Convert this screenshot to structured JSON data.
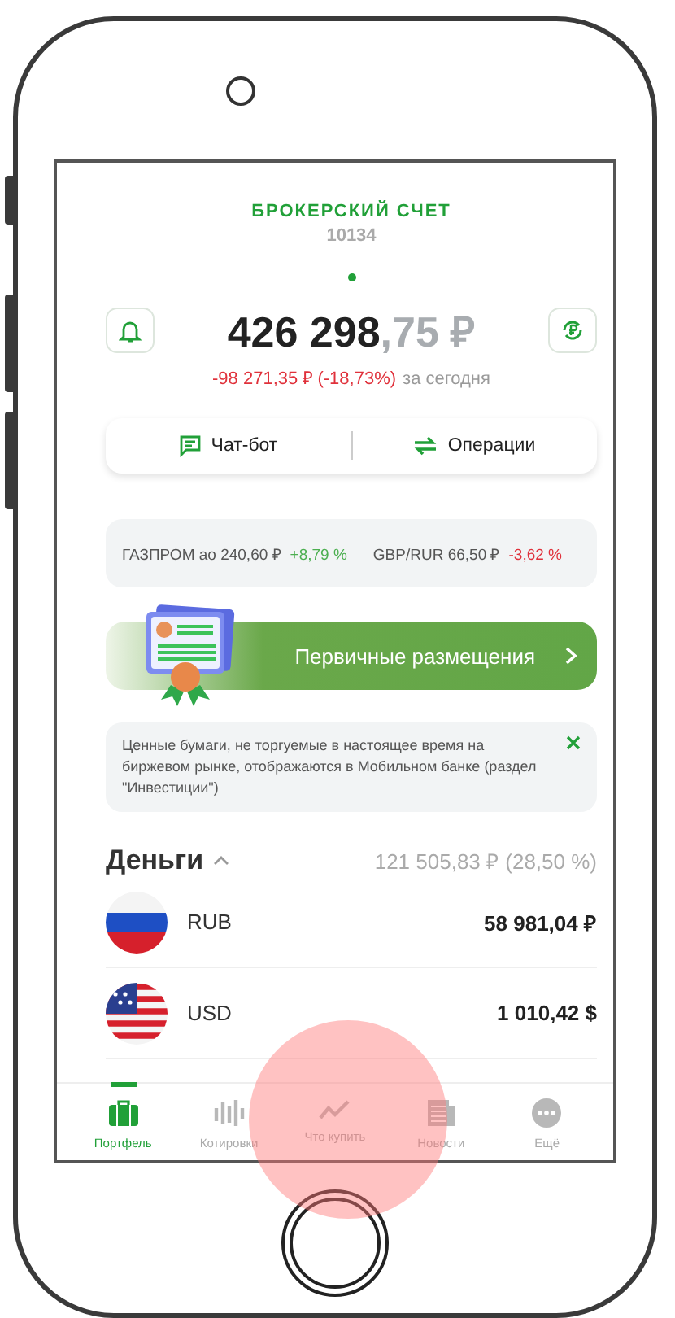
{
  "account": {
    "title": "БРОКЕРСКИЙ СЧЕТ",
    "number": "10134"
  },
  "balance": {
    "whole": "426 298",
    "fraction": ",75 ₽"
  },
  "change": {
    "value": "-98 271,35 ₽ (-18,73%)",
    "color": "#e0313b",
    "period": "за сегодня"
  },
  "actions": [
    {
      "label": "Чат-бот",
      "kind": "chat"
    },
    {
      "label": "Операции",
      "kind": "transfer"
    }
  ],
  "tickers": [
    {
      "name": "ГАЗПРОМ ао 240,60 ₽",
      "change": "+8,79 %",
      "color": "#4caf50"
    },
    {
      "name": "GBP/RUR 66,50 ₽",
      "change": "-3,62 %",
      "color": "#e0313b"
    }
  ],
  "banner": {
    "label": "Первичные размещения"
  },
  "notice": {
    "text": "Ценные бумаги, не торгуемые в настоящее время на биржевом рынке, отображаются в Мобильном банке (раздел \"Инвестиции\")"
  },
  "money": {
    "title": "Деньги",
    "expanded": true,
    "total": "121 505,83 ₽ (28,50 %)",
    "items": [
      {
        "code": "RUB",
        "amount": "58 981,04 ₽",
        "kind": "ru"
      },
      {
        "code": "USD",
        "amount": "1 010,42 $",
        "kind": "us"
      }
    ]
  },
  "tabs": [
    {
      "label": "Портфель",
      "kind": "portfolio",
      "selected": true
    },
    {
      "label": "Котировки",
      "kind": "quotes",
      "selected": false
    },
    {
      "label": "Что купить",
      "kind": "ideas",
      "selected": false
    },
    {
      "label": "Новости",
      "kind": "news",
      "selected": false
    },
    {
      "label": "Ещё",
      "kind": "more",
      "selected": false
    }
  ]
}
